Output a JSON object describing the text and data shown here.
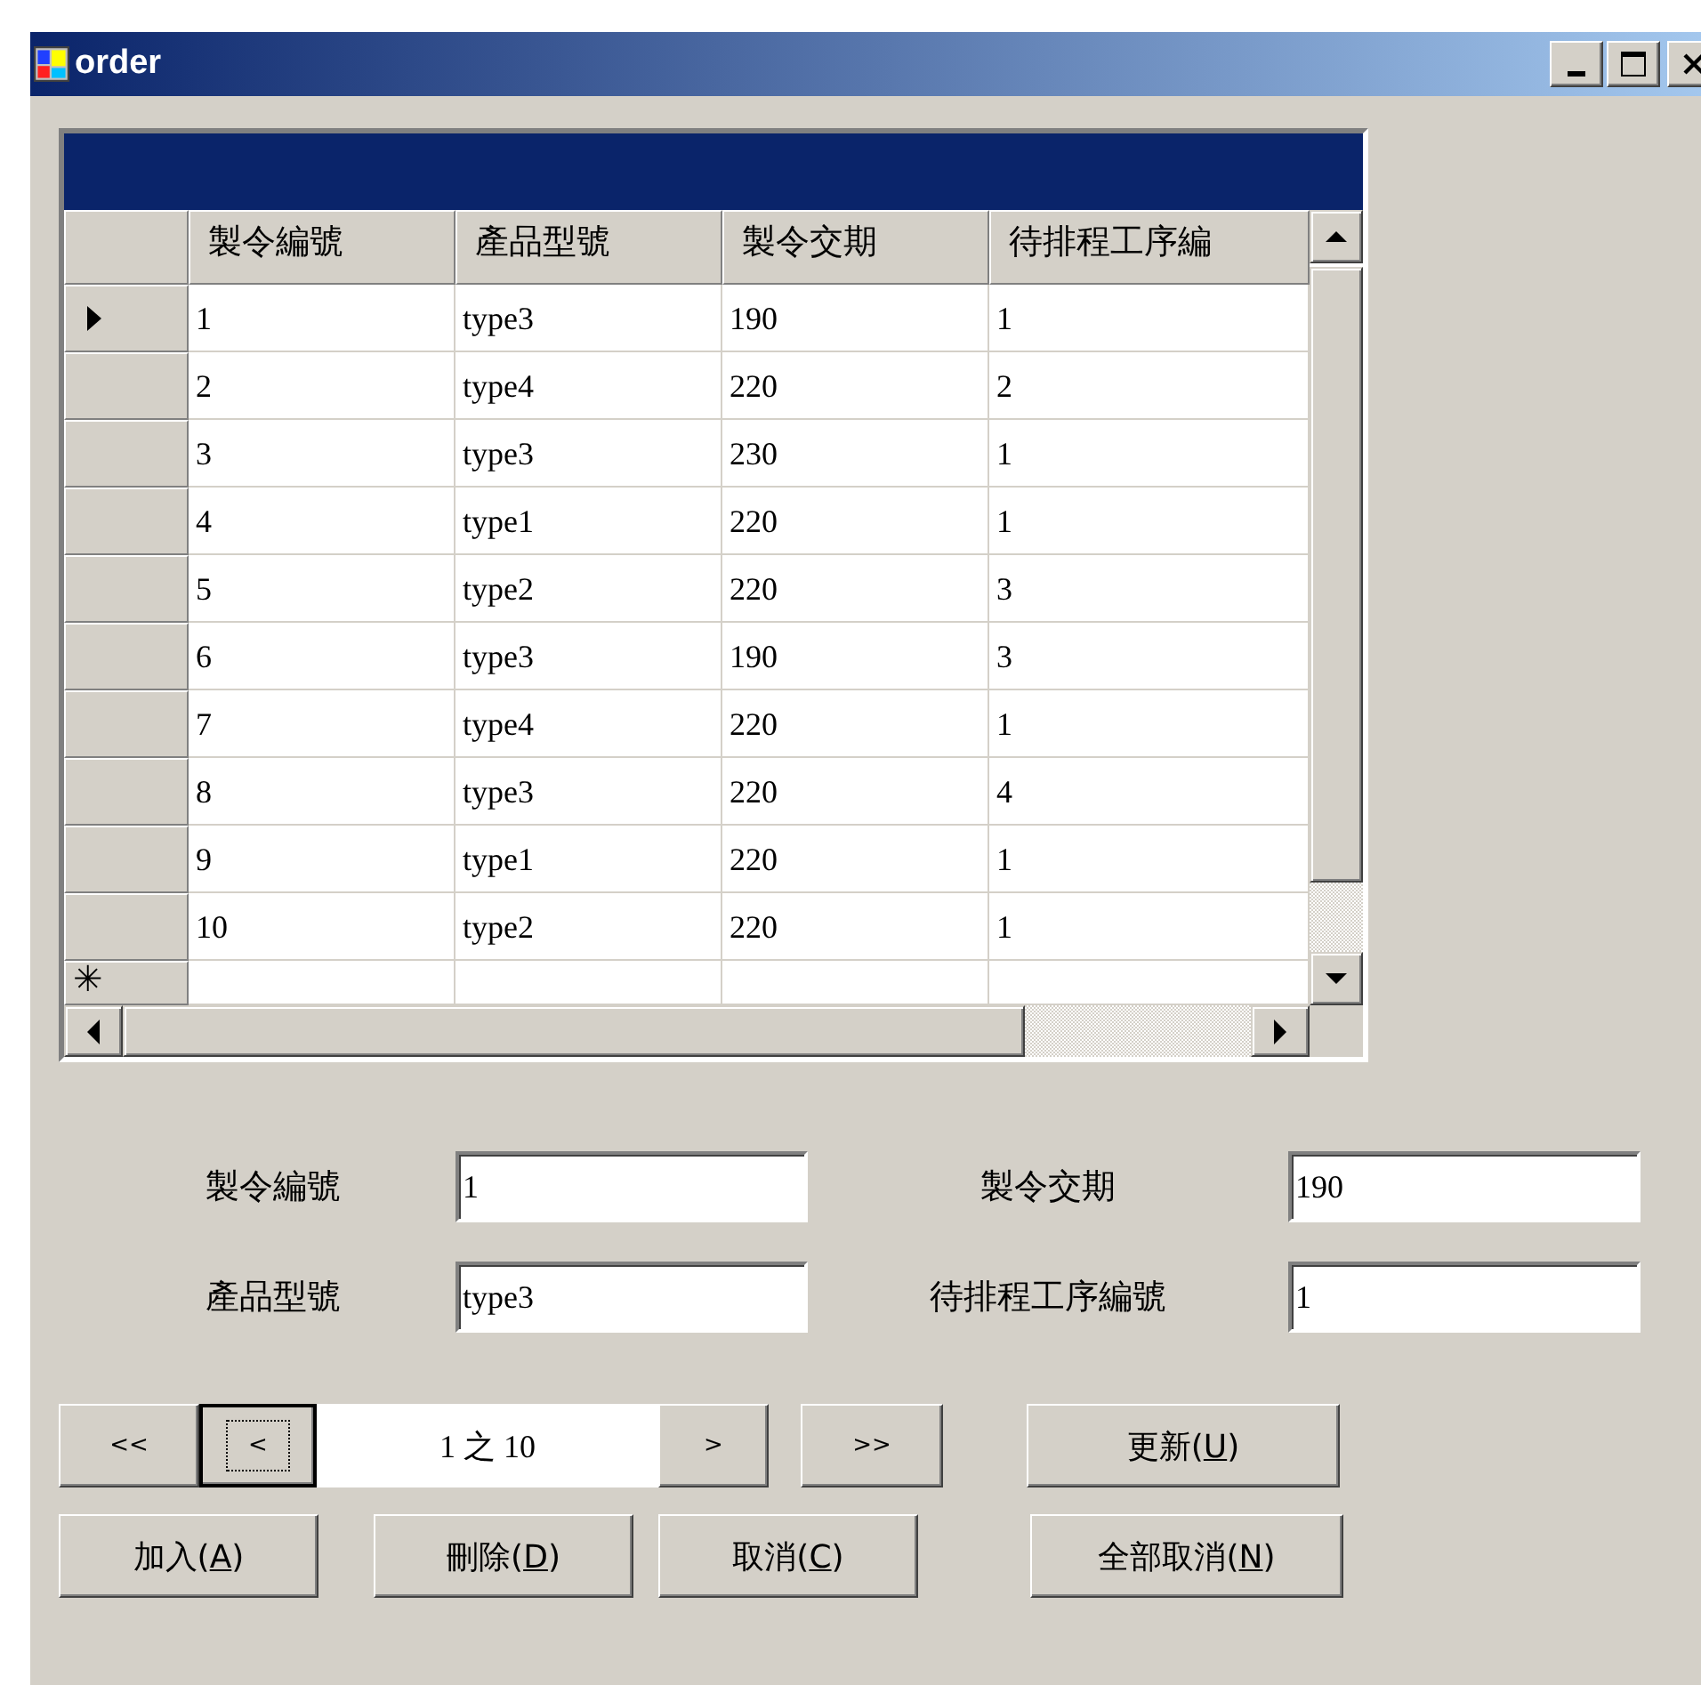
{
  "window": {
    "title": "order"
  },
  "grid": {
    "columns": [
      "製令編號",
      "產品型號",
      "製令交期",
      "待排程工序編"
    ],
    "rows": [
      {
        "current": true,
        "cells": [
          "1",
          "type3",
          "190",
          "1"
        ]
      },
      {
        "current": false,
        "cells": [
          "2",
          "type4",
          "220",
          "2"
        ]
      },
      {
        "current": false,
        "cells": [
          "3",
          "type3",
          "230",
          "1"
        ]
      },
      {
        "current": false,
        "cells": [
          "4",
          "type1",
          "220",
          "1"
        ]
      },
      {
        "current": false,
        "cells": [
          "5",
          "type2",
          "220",
          "3"
        ]
      },
      {
        "current": false,
        "cells": [
          "6",
          "type3",
          "190",
          "3"
        ]
      },
      {
        "current": false,
        "cells": [
          "7",
          "type4",
          "220",
          "1"
        ]
      },
      {
        "current": false,
        "cells": [
          "8",
          "type3",
          "220",
          "4"
        ]
      },
      {
        "current": false,
        "cells": [
          "9",
          "type1",
          "220",
          "1"
        ]
      },
      {
        "current": false,
        "cells": [
          "10",
          "type2",
          "220",
          "1"
        ]
      }
    ],
    "new_row_marker": "✳"
  },
  "fields": [
    {
      "label": "製令編號",
      "value": "1"
    },
    {
      "label": "製令交期",
      "value": "190"
    },
    {
      "label": "產品型號",
      "value": "type3"
    },
    {
      "label": "待排程工序編號",
      "value": "1"
    }
  ],
  "navigator": {
    "back_buttons": [
      {
        "label": "<<",
        "focused": false
      },
      {
        "label": "<",
        "focused": true
      }
    ],
    "position": "1 之 10",
    "forward_buttons": [
      {
        "label": ">",
        "focused": false
      },
      {
        "label": ">>",
        "focused": false
      }
    ]
  },
  "update_button": {
    "before": "更新(",
    "accel": "U",
    "after": ")"
  },
  "action_buttons": [
    {
      "before": "加入(",
      "accel": "A",
      "after": ")"
    },
    {
      "before": "刪除(",
      "accel": "D",
      "after": ")"
    },
    {
      "before": "取消(",
      "accel": "C",
      "after": ")"
    },
    {
      "before": "全部取消(",
      "accel": "N",
      "after": ")"
    }
  ]
}
